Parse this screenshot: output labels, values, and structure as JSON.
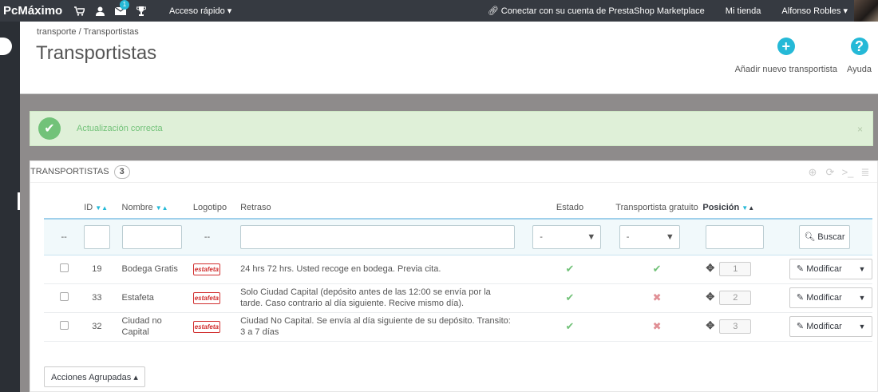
{
  "topbar": {
    "brand": "PcMáximo",
    "notif_count": "1",
    "quick_access": "Acceso rápido ▾",
    "marketplace": "Conectar con su cuenta de PrestaShop Marketplace",
    "my_store": "Mi tienda",
    "user": "Alfonso Robles ▾"
  },
  "breadcrumb": "transporte  /  Transportistas",
  "page_title": "Transportistas",
  "toolbar": {
    "add_label": "Añadir nuevo transportista",
    "help_label": "Ayuda"
  },
  "alert": {
    "text": "Actualización correcta",
    "close": "×"
  },
  "panel": {
    "title": "TRANSPORTISTAS",
    "count": "3"
  },
  "table": {
    "headers": {
      "id": "ID",
      "name": "Nombre",
      "logo": "Logotipo",
      "delay": "Retraso",
      "status": "Estado",
      "free": "Transportista gratuito",
      "position": "Posición"
    },
    "filter": {
      "dash": "--",
      "logo_dash": "--",
      "status_select": "-",
      "free_select": "-",
      "search": "Buscar"
    },
    "rows": [
      {
        "id": "19",
        "name": "Bodega Gratis",
        "logo": "estafeta",
        "delay": "24 hrs 72 hrs. Usted recoge en bodega. Previa cita.",
        "status": "✔",
        "free": "✔",
        "position": "1",
        "action": "Modificar"
      },
      {
        "id": "33",
        "name": "Estafeta",
        "logo": "estafeta",
        "delay": "Solo Ciudad Capital (depósito antes de las 12:00 se envía por la tarde. Caso contrario al día siguiente. Recive mismo día).",
        "status": "✔",
        "free": "✖",
        "position": "2",
        "action": "Modificar"
      },
      {
        "id": "32",
        "name": "Ciudad no Capital",
        "logo": "estafeta",
        "delay": "Ciudad No Capital. Se envía al día siguiente de su depósito. Transito: 3 a 7 días",
        "status": "✔",
        "free": "✖",
        "position": "3",
        "action": "Modificar"
      }
    ]
  },
  "bulk_actions": "Acciones Agrupadas ▴",
  "icons": {
    "cart": "cart-icon",
    "user": "user-icon",
    "mail": "mail-icon",
    "trophy": "trophy-icon",
    "add": "plus-circle-icon",
    "help": "question-circle-icon",
    "check": "check-icon",
    "cross": "cross-icon"
  },
  "colors": {
    "accent": "#25b9d7",
    "success": "#72c279",
    "danger": "#e08f95",
    "topbar": "#363a41"
  }
}
